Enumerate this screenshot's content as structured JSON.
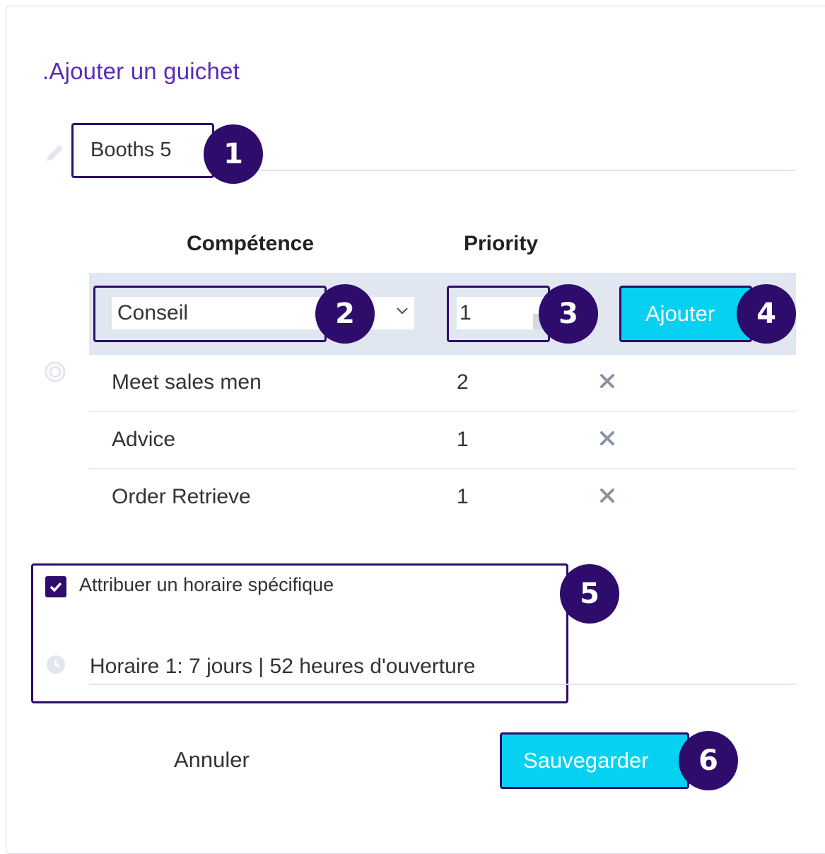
{
  "dialog": {
    "title": ".Ajouter un guichet",
    "name_value": "Booths 5",
    "badges": [
      "1",
      "2",
      "3",
      "4",
      "5",
      "6"
    ]
  },
  "skills": {
    "header_skill": "Compétence",
    "header_priority": "Priority",
    "select_value": "Conseil",
    "priority_value": "1",
    "add_label": "Ajouter",
    "rows": [
      {
        "name": "Meet sales men",
        "priority": "2"
      },
      {
        "name": "Advice",
        "priority": "1"
      },
      {
        "name": "Order Retrieve",
        "priority": "1"
      }
    ]
  },
  "schedule": {
    "checkbox_label": "Attribuer un horaire spécifique",
    "checked": true,
    "summary": "Horaire 1: 7 jours | 52 heures d'ouverture"
  },
  "footer": {
    "cancel_label": "Annuler",
    "save_label": "Sauvegarder"
  },
  "colors": {
    "accent_dark": "#2e0c6b",
    "button_cyan": "#06d1f0",
    "title_purple": "#5b2bb5"
  },
  "icons": [
    "pencil-icon",
    "target-icon",
    "chevron-down-icon",
    "close-icon",
    "check-icon",
    "clock-icon"
  ]
}
